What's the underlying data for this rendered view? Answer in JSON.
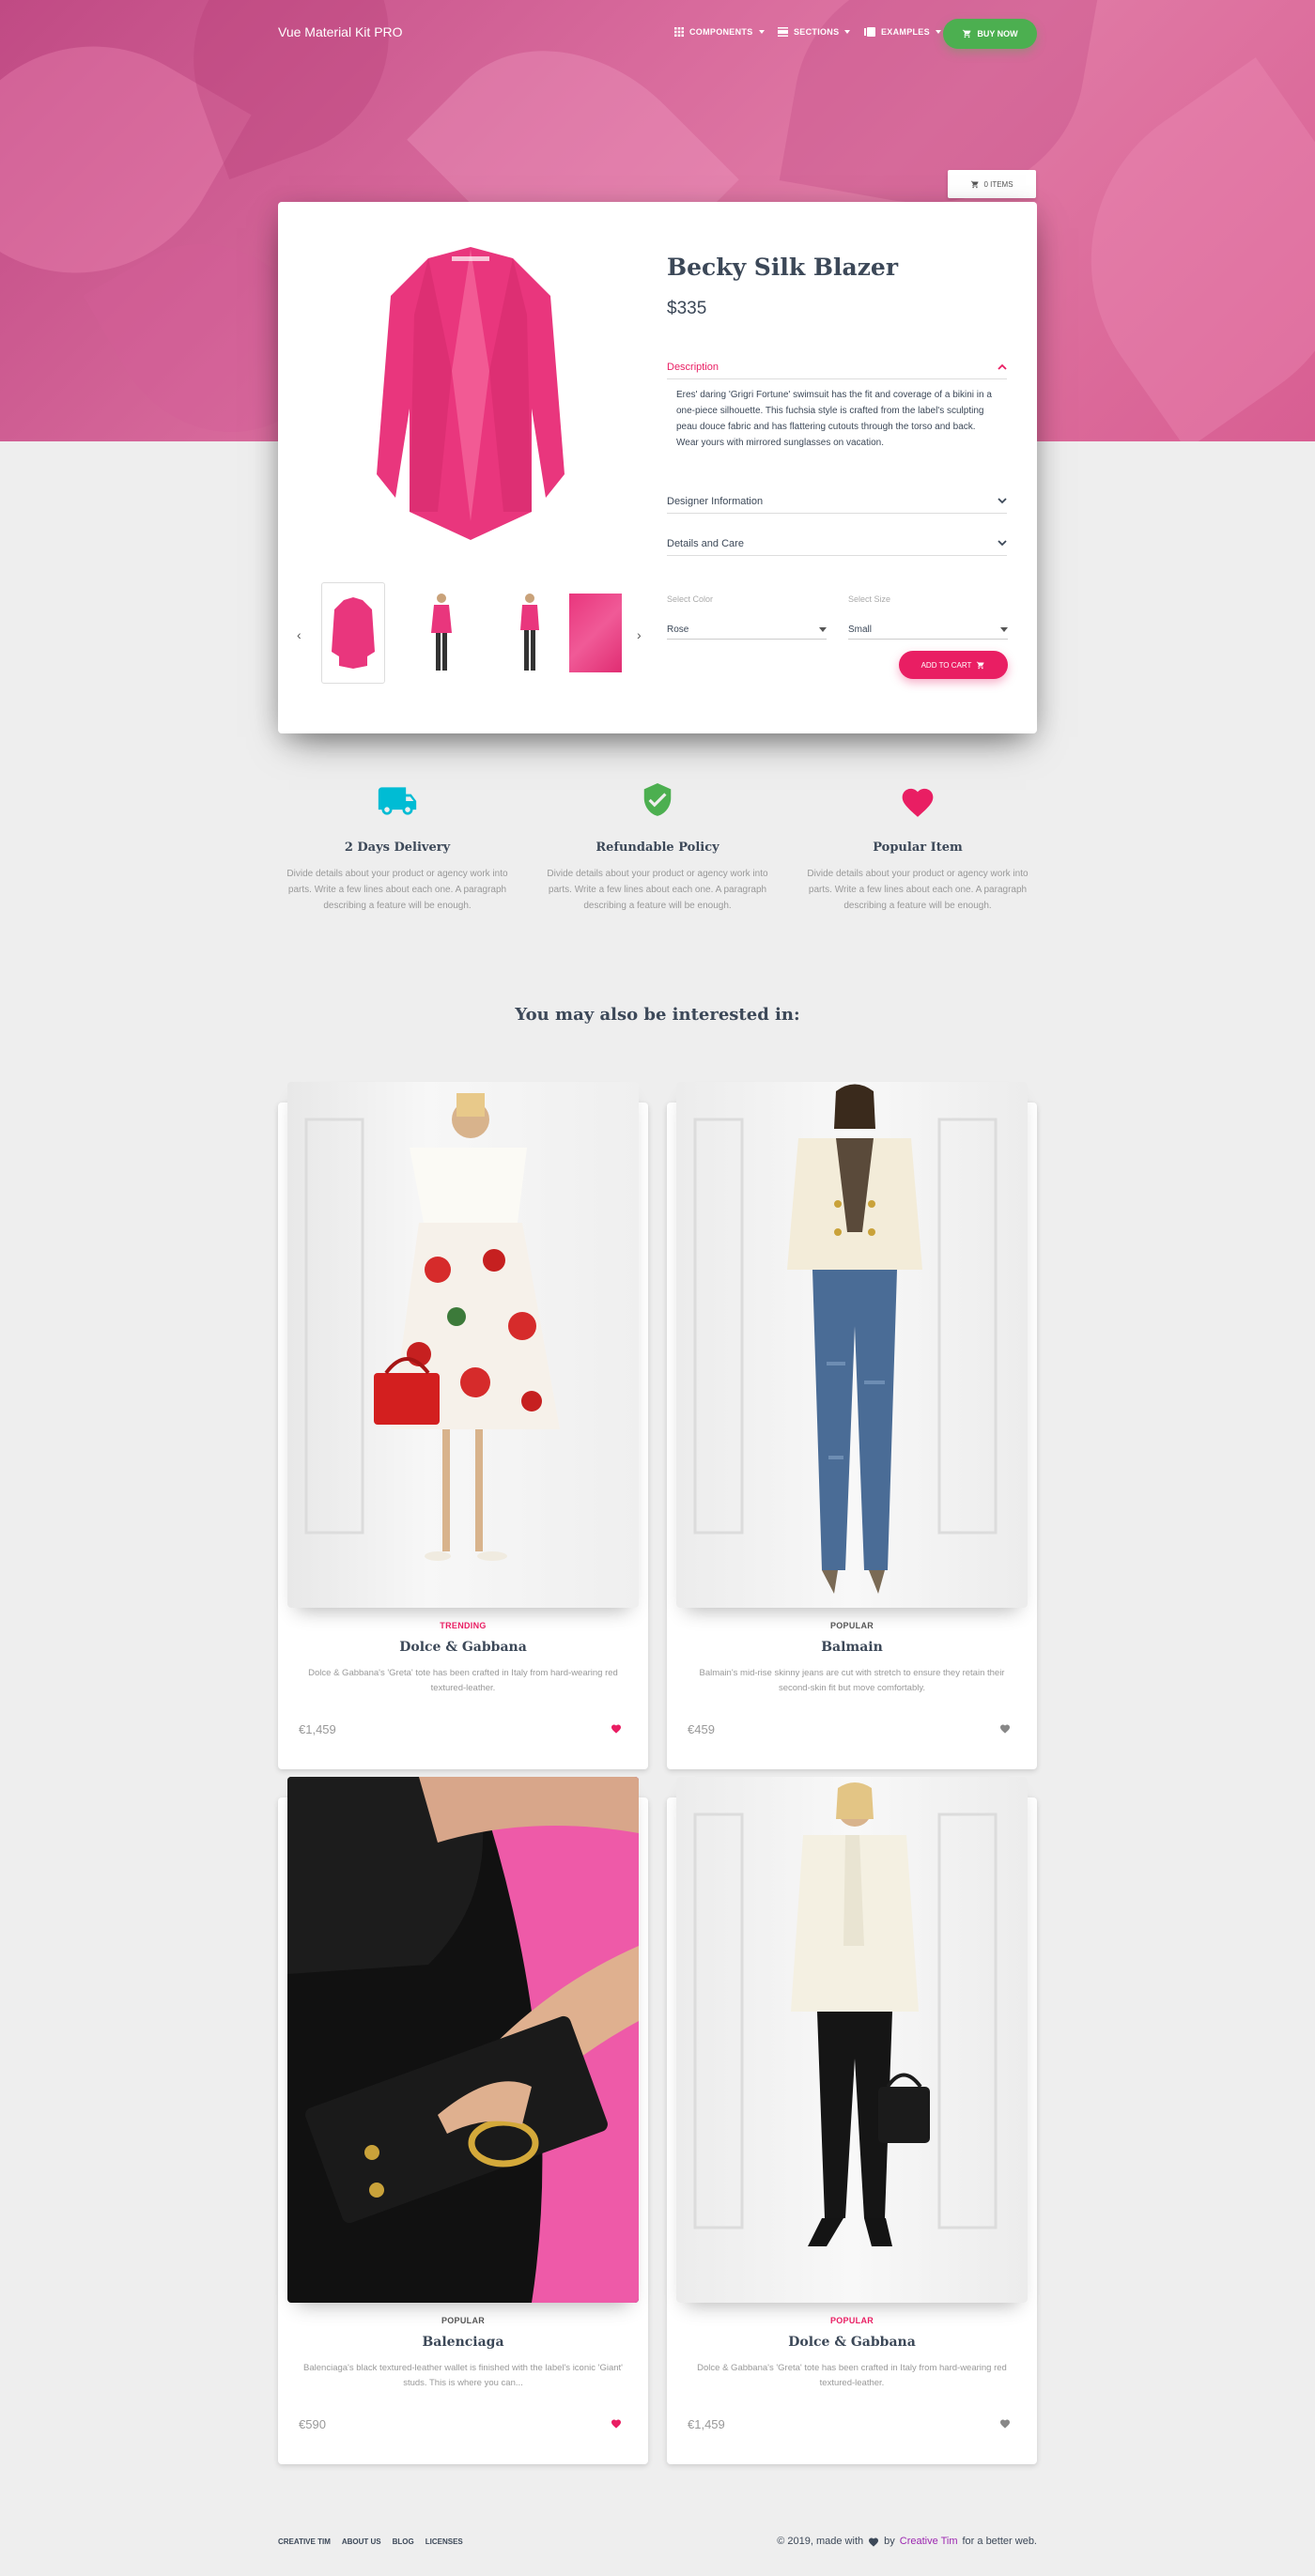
{
  "nav": {
    "brand": "Vue Material Kit PRO",
    "items": [
      {
        "label": "COMPONENTS",
        "icon": "apps-icon"
      },
      {
        "label": "SECTIONS",
        "icon": "view-day-icon"
      },
      {
        "label": "EXAMPLES",
        "icon": "photo-library-icon"
      }
    ],
    "buy_label": "BUY NOW"
  },
  "cart": {
    "label": "0 ITEMS"
  },
  "product": {
    "title": "Becky Silk Blazer",
    "price": "$335",
    "accordion": [
      {
        "title": "Description",
        "expanded": true,
        "body": "Eres' daring 'Grigri Fortune' swimsuit has the fit and coverage of a bikini in a one-piece silhouette. This fuchsia style is crafted from the label's sculpting peau douce fabric and has flattering cutouts through the torso and back. Wear yours with mirrored sunglasses on vacation."
      },
      {
        "title": "Designer Information",
        "expanded": false
      },
      {
        "title": "Details and Care",
        "expanded": false
      }
    ],
    "color_label": "Select Color",
    "color_value": "Rose",
    "size_label": "Select Size",
    "size_value": "Small",
    "add_to_cart": "ADD TO CART",
    "accent": "#e91e63"
  },
  "features": [
    {
      "title": "2 Days Delivery",
      "text": "Divide details about your product or agency work into parts. Write a few lines about each one. A paragraph describing a feature will be enough.",
      "icon": "local-shipping-icon",
      "color": "#00bcd4"
    },
    {
      "title": "Refundable Policy",
      "text": "Divide details about your product or agency work into parts. Write a few lines about each one. A paragraph describing a feature will be enough.",
      "icon": "verified-user-icon",
      "color": "#4caf50"
    },
    {
      "title": "Popular Item",
      "text": "Divide details about your product or agency work into parts. Write a few lines about each one. A paragraph describing a feature will be enough.",
      "icon": "favorite-icon",
      "color": "#e91e63"
    }
  ],
  "interested_title": "You may also be interested in:",
  "products": [
    {
      "tag": "TRENDING",
      "tag_color": "#e91e63",
      "name": "Dolce & Gabbana",
      "desc": "Dolce & Gabbana's 'Greta' tote has been crafted in Italy from hard-wearing red textured-leather.",
      "price": "€1,459",
      "liked": true
    },
    {
      "tag": "POPULAR",
      "tag_color": "#555555",
      "name": "Balmain",
      "desc": "Balmain's mid-rise skinny jeans are cut with stretch to ensure they retain their second-skin fit but move comfortably.",
      "price": "€459",
      "liked": false
    },
    {
      "tag": "POPULAR",
      "tag_color": "#555555",
      "name": "Balenciaga",
      "desc": "Balenciaga's black textured-leather wallet is finished with the label's iconic 'Giant' studs. This is where you can...",
      "price": "€590",
      "liked": true
    },
    {
      "tag": "POPULAR",
      "tag_color": "#e91e63",
      "name": "Dolce & Gabbana",
      "desc": "Dolce & Gabbana's 'Greta' tote has been crafted in Italy from hard-wearing red textured-leather.",
      "price": "€1,459",
      "liked": false
    }
  ],
  "footer": {
    "links": [
      "CREATIVE TIM",
      "ABOUT US",
      "BLOG",
      "LICENSES"
    ],
    "copy_prefix": "© 2019, made with",
    "copy_by": "by",
    "copy_brand": "Creative Tim",
    "copy_suffix": "for a better web."
  }
}
